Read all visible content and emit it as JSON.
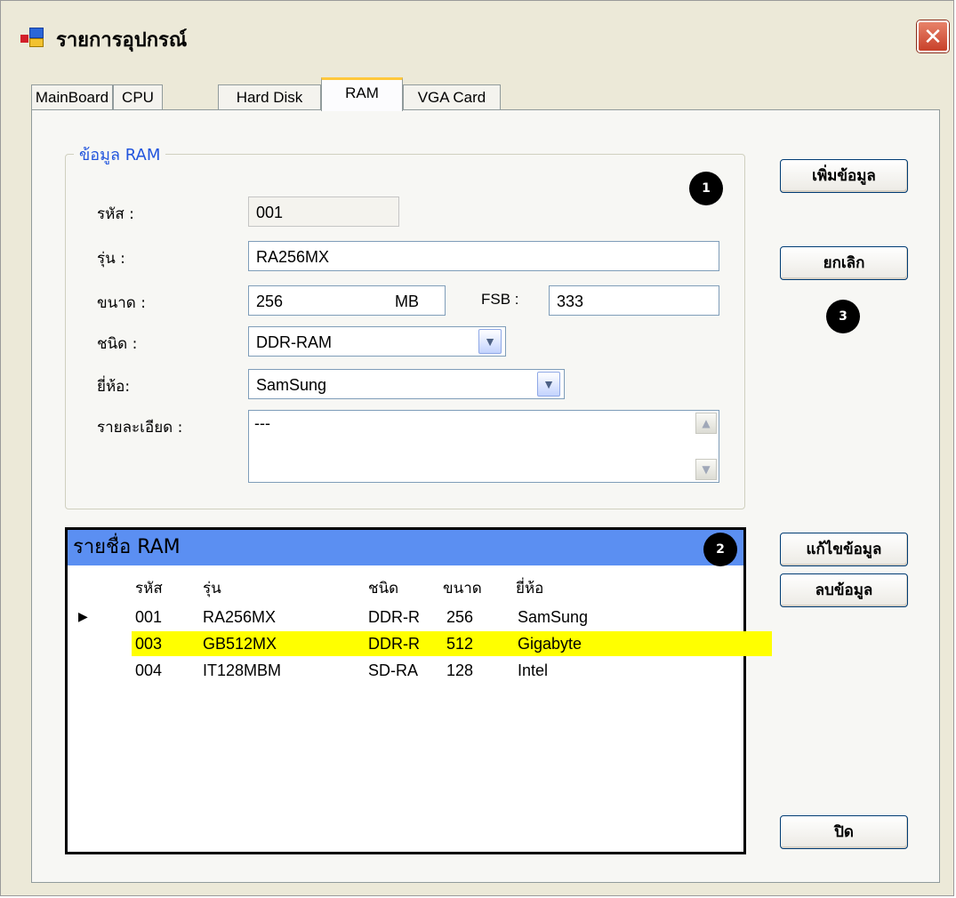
{
  "window": {
    "title": "รายการอุปกรณ์",
    "close_symbol": "✕"
  },
  "tabs": [
    {
      "label": "MainBoard"
    },
    {
      "label": "CPU"
    },
    {
      "label": "Hard Disk"
    },
    {
      "label": "RAM",
      "active": true
    },
    {
      "label": "VGA Card"
    }
  ],
  "form": {
    "group_title": "ข้อมูล RAM",
    "code_label": "รหัส :",
    "code_value": "001",
    "model_label": "รุ่น :",
    "model_value": "RA256MX",
    "size_label": "ขนาด :",
    "size_value": "256",
    "size_unit": "MB",
    "fsb_label": "FSB :",
    "fsb_value": "333",
    "type_label": "ชนิด  :",
    "type_value": "DDR-RAM",
    "brand_label": "ยี่ห้อ:",
    "brand_value": "SamSung",
    "detail_label": "รายละเอียด :",
    "detail_value": "---"
  },
  "buttons": {
    "add": "เพิ่มข้อมูล",
    "cancel": "ยกเลิก",
    "edit": "แก้ไขข้อมูล",
    "delete": "ลบข้อมูล",
    "close": "ปิด"
  },
  "badges": [
    "1",
    "2",
    "3"
  ],
  "grid": {
    "caption": "รายชื่อ RAM",
    "columns": [
      "รหัส",
      "รุ่น",
      "ชนิด",
      "ขนาด",
      "ยี่ห้อ"
    ],
    "rows": [
      {
        "code": "001",
        "model": "RA256MX",
        "type": "DDR-R",
        "size": "256",
        "brand": "SamSung",
        "current": true
      },
      {
        "code": "003",
        "model": "GB512MX",
        "type": "DDR-R",
        "size": "512",
        "brand": "Gigabyte",
        "highlight_color": "#ffff00"
      },
      {
        "code": "004",
        "model": "IT128MBM",
        "type": "SD-RA",
        "size": "128",
        "brand": "Intel"
      }
    ]
  },
  "colors": {
    "caption_bar": "#5b8ff2",
    "group_title": "#2255dd",
    "selected_row": "#ffff00"
  }
}
